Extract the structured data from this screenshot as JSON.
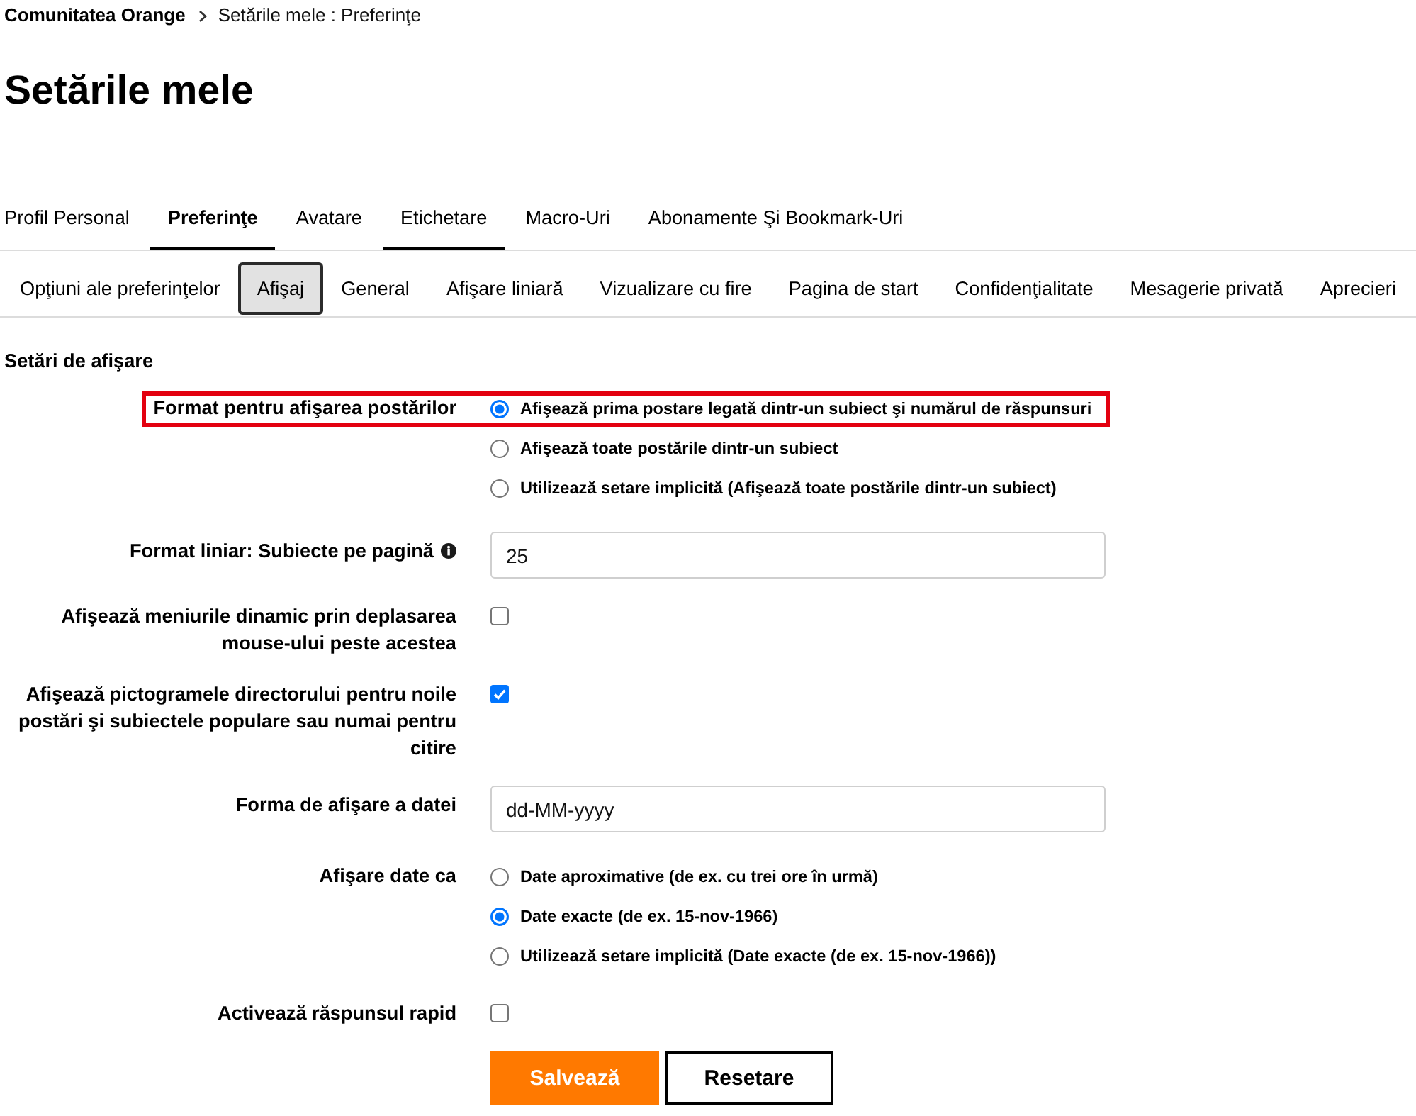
{
  "breadcrumb": [
    {
      "label": "Comunitatea Orange",
      "current": false
    },
    {
      "label": "Setările mele : Preferinţe",
      "current": true
    }
  ],
  "page_title": "Setările mele",
  "primary_tabs": [
    {
      "label": "Profil Personal",
      "selected": false,
      "hovered": false
    },
    {
      "label": "Preferinţe",
      "selected": true,
      "hovered": false
    },
    {
      "label": "Avatare",
      "selected": false,
      "hovered": false
    },
    {
      "label": "Etichetare",
      "selected": false,
      "hovered": true
    },
    {
      "label": "Macro-Uri",
      "selected": false,
      "hovered": false
    },
    {
      "label": "Abonamente Şi Bookmark-Uri",
      "selected": false,
      "hovered": false
    }
  ],
  "secondary_tabs": [
    {
      "label": "Opţiuni ale preferinţelor",
      "selected": false
    },
    {
      "label": "Afişaj",
      "selected": true
    },
    {
      "label": "General",
      "selected": false
    },
    {
      "label": "Afişare liniară",
      "selected": false
    },
    {
      "label": "Vizualizare cu fire",
      "selected": false
    },
    {
      "label": "Pagina de start",
      "selected": false
    },
    {
      "label": "Confidenţialitate",
      "selected": false
    },
    {
      "label": "Mesagerie privată",
      "selected": false
    },
    {
      "label": "Aprecieri",
      "selected": false
    }
  ],
  "section_title": "Setări de afişare",
  "settings": [
    {
      "kind": "radio",
      "label": "Format pentru afişarea postărilor",
      "highlighted": true,
      "info": false,
      "options": [
        {
          "label": "Afişează prima postare legată dintr-un subiect şi numărul de răspunsuri",
          "selected": true
        },
        {
          "label": "Afişează toate postările dintr-un subiect",
          "selected": false
        },
        {
          "label": "Utilizează setare implicită (Afişează toate postările dintr-un subiect)",
          "selected": false
        }
      ]
    },
    {
      "kind": "text",
      "label": "Format liniar: Subiecte pe pagină",
      "highlighted": false,
      "info": true,
      "value": "25"
    },
    {
      "kind": "checkbox",
      "label": "Afişează meniurile dinamic prin deplasarea mouse-ului peste acestea",
      "highlighted": false,
      "info": false,
      "checked": false
    },
    {
      "kind": "checkbox",
      "label": "Afişează pictogramele directorului pentru noile postări şi subiectele populare sau numai pentru citire",
      "highlighted": false,
      "info": false,
      "checked": true
    },
    {
      "kind": "text",
      "label": "Forma de afişare a datei",
      "highlighted": false,
      "info": false,
      "value": "dd-MM-yyyy"
    },
    {
      "kind": "radio",
      "label": "Afişare date ca",
      "highlighted": false,
      "info": false,
      "options": [
        {
          "label": "Date aproximative (de ex. cu trei ore în urmă)",
          "selected": false
        },
        {
          "label": "Date exacte (de ex. 15-nov-1966)",
          "selected": true
        },
        {
          "label": "Utilizează setare implicită (Date exacte (de ex. 15-nov-1966))",
          "selected": false
        }
      ]
    },
    {
      "kind": "checkbox",
      "label": "Activează răspunsul rapid",
      "highlighted": false,
      "info": false,
      "checked": false
    }
  ],
  "buttons": [
    {
      "label": "Salvează",
      "kind": "primary"
    },
    {
      "label": "Resetare",
      "kind": "secondary"
    }
  ]
}
